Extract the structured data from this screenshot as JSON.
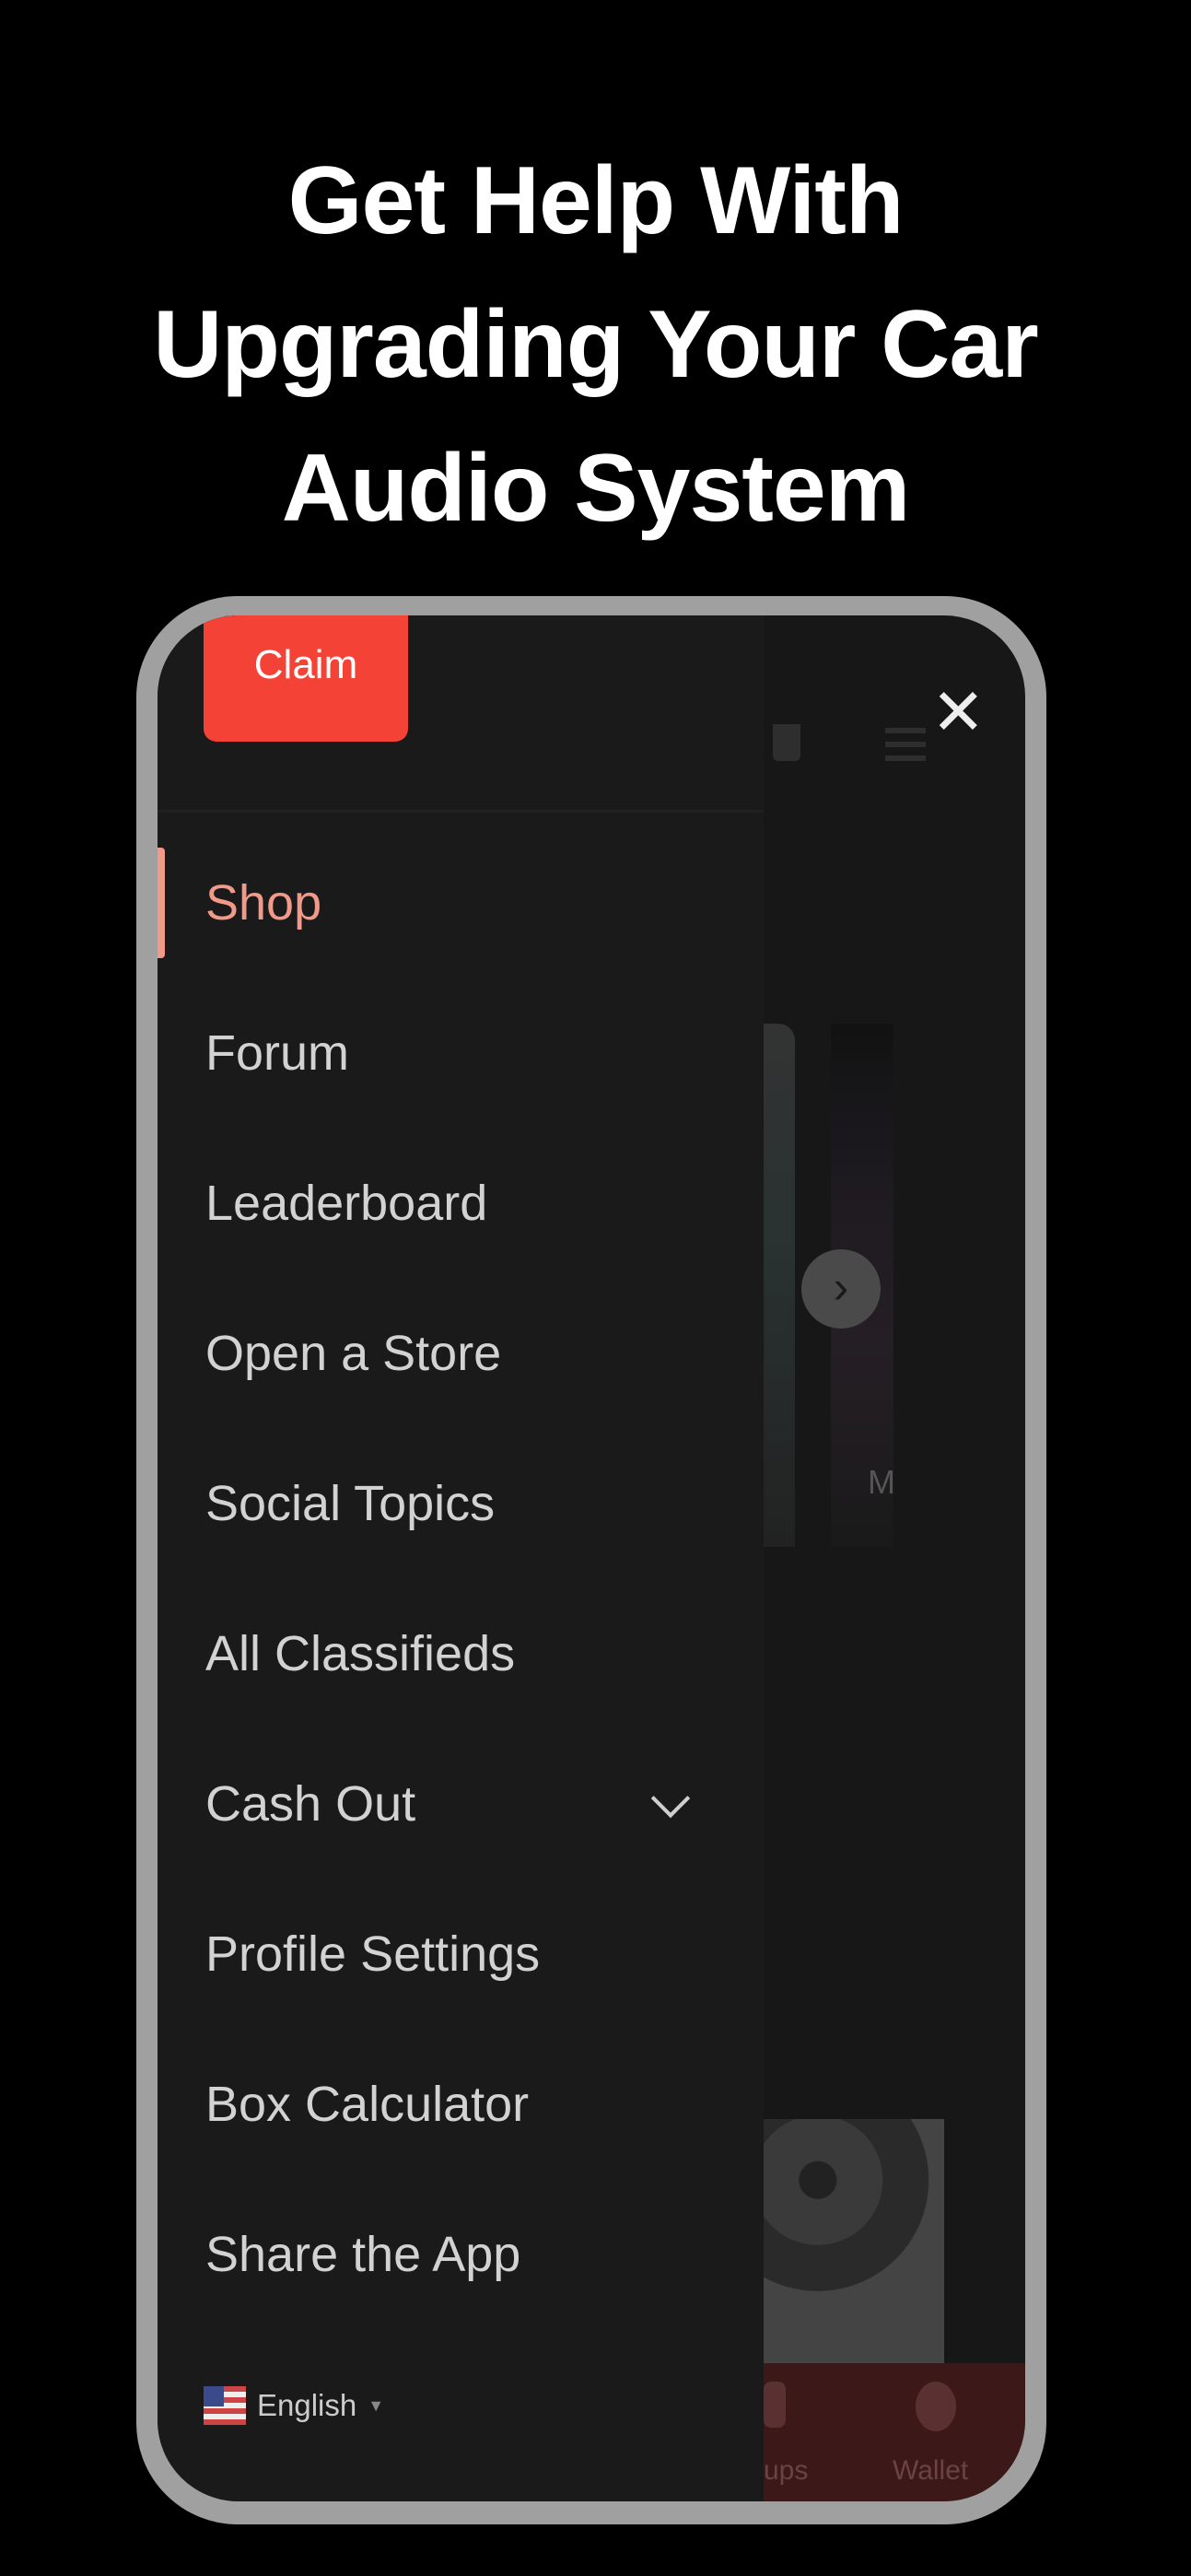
{
  "headline": [
    "Get Help With",
    "Upgrading Your Car",
    "Audio System"
  ],
  "drawer": {
    "claim_label": "Claim",
    "items": [
      {
        "label": "Shop",
        "active": true
      },
      {
        "label": "Forum"
      },
      {
        "label": "Leaderboard"
      },
      {
        "label": "Open a Store"
      },
      {
        "label": "Social Topics"
      },
      {
        "label": "All Classifieds"
      },
      {
        "label": "Cash Out",
        "expandable": true
      },
      {
        "label": "Profile Settings"
      },
      {
        "label": "Box Calculator"
      },
      {
        "label": "Share the App"
      }
    ],
    "language": "English",
    "close_icon": "close-icon"
  },
  "background": {
    "card_label_partial": "M",
    "bottom_nav": [
      {
        "label": "ups"
      },
      {
        "label": "Wallet"
      }
    ]
  },
  "colors": {
    "accent": "#f44336",
    "active_item": "#f29a8a",
    "nav_bg": "#3d1818"
  }
}
